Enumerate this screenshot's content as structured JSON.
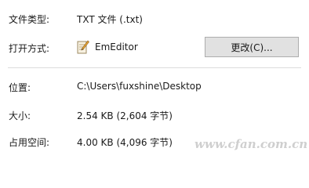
{
  "properties": {
    "file_type": {
      "label": "文件类型:",
      "value": "TXT 文件 (.txt)"
    },
    "opens_with": {
      "label": "打开方式:",
      "app_name": "EmEditor",
      "change_button": "更改(C)..."
    },
    "location": {
      "label": "位置:",
      "value": "C:\\Users\\fuxshine\\Desktop"
    },
    "size": {
      "label": "大小:",
      "value": "2.54 KB (2,604 字节)"
    },
    "size_on_disk": {
      "label": "占用空间:",
      "value": "4.00 KB (4,096 字节)"
    }
  },
  "icons": {
    "app_icon": "emeditor-notepad-pen-icon"
  },
  "watermark": "www.cfan.com.cn"
}
